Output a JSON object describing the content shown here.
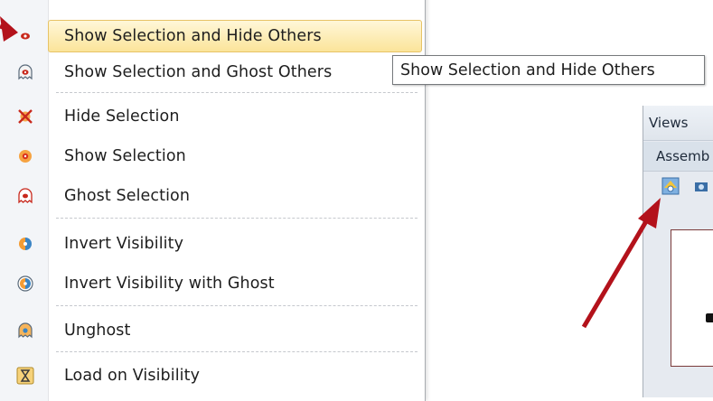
{
  "menu": {
    "items": [
      {
        "label": "Show Selection and Hide Others",
        "icon": "show-selection-hide-others-icon",
        "highlighted": true
      },
      {
        "label": "Show Selection and Ghost Others",
        "icon": "show-selection-ghost-others-icon"
      },
      {
        "label": "Hide Selection",
        "icon": "hide-selection-icon"
      },
      {
        "label": "Show Selection",
        "icon": "show-selection-icon"
      },
      {
        "label": "Ghost Selection",
        "icon": "ghost-selection-icon"
      },
      {
        "label": "Invert Visibility",
        "icon": "invert-visibility-icon"
      },
      {
        "label": "Invert Visibility with Ghost",
        "icon": "invert-visibility-ghost-icon"
      },
      {
        "label": "Unghost",
        "icon": "unghost-icon"
      },
      {
        "label": "Load on Visibility",
        "icon": "load-on-visibility-icon"
      }
    ]
  },
  "tooltip": {
    "text": "Show Selection and Hide Others"
  },
  "views_panel": {
    "title": "Views",
    "tab": "Assemb"
  },
  "colors": {
    "highlight": "#fbe49a",
    "arrow": "#b3121b",
    "icon_red": "#c8281c",
    "icon_orange": "#f08c1e"
  }
}
